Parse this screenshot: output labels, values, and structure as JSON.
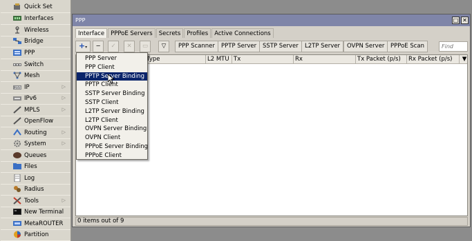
{
  "sidebar": {
    "items": [
      {
        "label": "Quick Set",
        "icon": "quick-set-icon",
        "arrow": false
      },
      {
        "label": "Interfaces",
        "icon": "interfaces-icon",
        "arrow": false
      },
      {
        "label": "Wireless",
        "icon": "wireless-icon",
        "arrow": false
      },
      {
        "label": "Bridge",
        "icon": "bridge-icon",
        "arrow": false
      },
      {
        "label": "PPP",
        "icon": "ppp-icon",
        "arrow": false
      },
      {
        "label": "Switch",
        "icon": "switch-icon",
        "arrow": false
      },
      {
        "label": "Mesh",
        "icon": "mesh-icon",
        "arrow": false
      },
      {
        "label": "IP",
        "icon": "ip-icon",
        "arrow": true
      },
      {
        "label": "IPv6",
        "icon": "ipv6-icon",
        "arrow": true
      },
      {
        "label": "MPLS",
        "icon": "mpls-icon",
        "arrow": true
      },
      {
        "label": "OpenFlow",
        "icon": "openflow-icon",
        "arrow": false
      },
      {
        "label": "Routing",
        "icon": "routing-icon",
        "arrow": true
      },
      {
        "label": "System",
        "icon": "system-icon",
        "arrow": true
      },
      {
        "label": "Queues",
        "icon": "queues-icon",
        "arrow": false
      },
      {
        "label": "Files",
        "icon": "files-icon",
        "arrow": false
      },
      {
        "label": "Log",
        "icon": "log-icon",
        "arrow": false
      },
      {
        "label": "Radius",
        "icon": "radius-icon",
        "arrow": false
      },
      {
        "label": "Tools",
        "icon": "tools-icon",
        "arrow": true
      },
      {
        "label": "New Terminal",
        "icon": "terminal-icon",
        "arrow": false
      },
      {
        "label": "MetaROUTER",
        "icon": "metarouter-icon",
        "arrow": false
      },
      {
        "label": "Partition",
        "icon": "partition-icon",
        "arrow": false
      }
    ]
  },
  "window": {
    "title": "PPP",
    "tabs": [
      "Interface",
      "PPPoE Servers",
      "Secrets",
      "Profiles",
      "Active Connections"
    ],
    "toolbar": {
      "add_label": "+",
      "buttons": [
        "PPP Scanner",
        "PPTP Server",
        "SSTP Server",
        "L2TP Server",
        "OVPN Server",
        "PPPoE Scan"
      ],
      "find_placeholder": "Find"
    },
    "columns": [
      "Type",
      "L2 MTU",
      "Tx",
      "Rx",
      "Tx Packet (p/s)",
      "Rx Packet (p/s)"
    ],
    "status": "0 items out of 9"
  },
  "dropdown": {
    "items": [
      "PPP Server",
      "PPP Client",
      "PPTP Server Binding",
      "PPTP Client",
      "SSTP Server Binding",
      "SSTP Client",
      "L2TP Server Binding",
      "L2TP Client",
      "OVPN Server Binding",
      "OVPN Client",
      "PPPoE Server Binding",
      "PPPoE Client"
    ],
    "selected_index": 2
  },
  "colors": {
    "titlebar": "#7f85a8",
    "selection": "#0a246a",
    "sidebar": "#d9d6cc",
    "desktop": "#8c8c8c"
  }
}
